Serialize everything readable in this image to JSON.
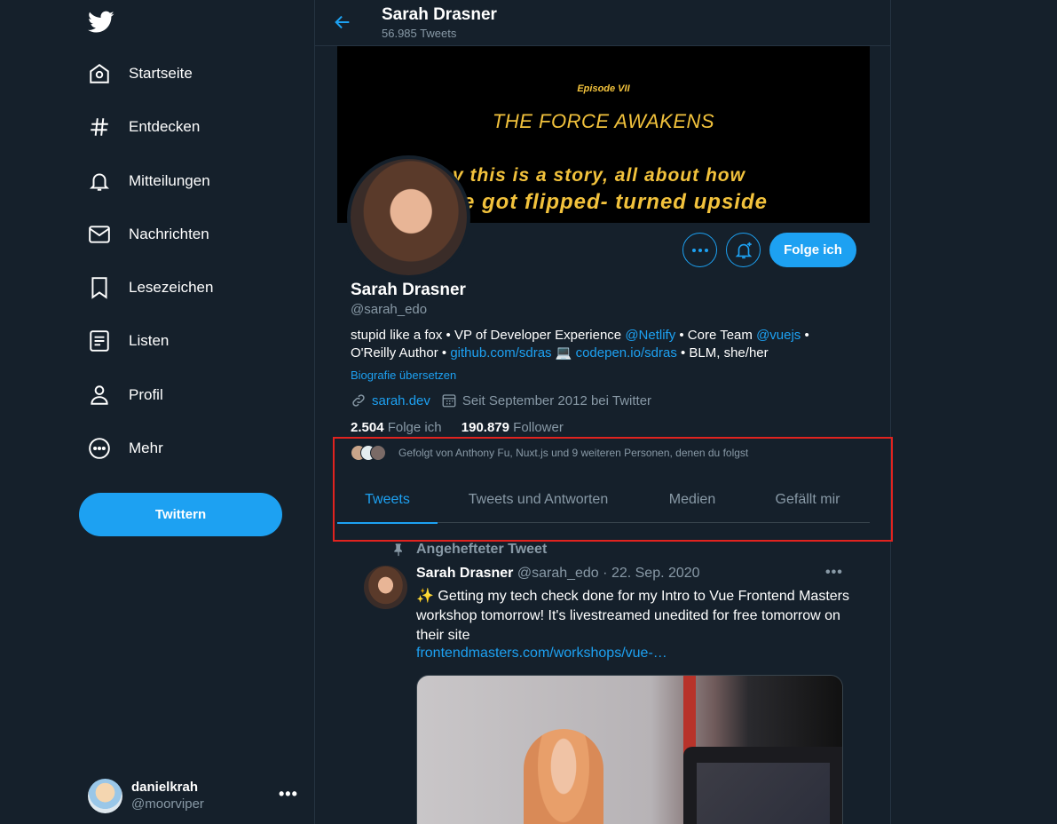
{
  "sidebar": {
    "logo": "twitter-bird-icon",
    "items": [
      {
        "label": "Startseite",
        "icon": "home-icon"
      },
      {
        "label": "Entdecken",
        "icon": "hashtag-icon"
      },
      {
        "label": "Mitteilungen",
        "icon": "bell-icon"
      },
      {
        "label": "Nachrichten",
        "icon": "mail-icon"
      },
      {
        "label": "Lesezeichen",
        "icon": "bookmark-icon"
      },
      {
        "label": "Listen",
        "icon": "list-icon"
      },
      {
        "label": "Profil",
        "icon": "profile-icon"
      },
      {
        "label": "Mehr",
        "icon": "more-circle-icon"
      }
    ],
    "tweet_button": "Twittern",
    "account": {
      "display_name": "danielkrah",
      "handle": "@moorviper",
      "more": "•••"
    }
  },
  "header": {
    "name": "Sarah Drasner",
    "tweet_count": "56.985 Tweets"
  },
  "banner": {
    "episode": "Episode VII",
    "title": "THE FORCE AWAKENS",
    "crawl_line1": "v this is a story, all about how",
    "crawl_line2": "fe got flipped- turned upside"
  },
  "profile": {
    "name": "Sarah Drasner",
    "handle": "@sarah_edo",
    "follow_button": "Folge ich",
    "more_button": "•••",
    "bio": {
      "part1": "stupid like a fox • VP of Developer Experience ",
      "link1": "@Netlify",
      "part2": " • Core Team ",
      "link2": "@vuejs",
      "part3": " • O'Reilly Author • ",
      "link3": "github.com/sdras",
      "part4": " 💻 ",
      "link4": "codepen.io/sdras",
      "part5": " • BLM, she/her"
    },
    "translate": "Biografie übersetzen",
    "website": "sarah.dev",
    "joined": "Seit September 2012 bei Twitter",
    "following_count": "2.504",
    "following_label": "Folge ich",
    "followers_count": "190.879",
    "followers_label": "Follower",
    "followed_by": "Gefolgt von Anthony Fu, Nuxt.js und 9 weiteren Personen, denen du folgst"
  },
  "tabs": [
    {
      "label": "Tweets",
      "active": true
    },
    {
      "label": "Tweets und Antworten",
      "active": false
    },
    {
      "label": "Medien",
      "active": false
    },
    {
      "label": "Gefällt mir",
      "active": false
    }
  ],
  "pinned_tweet": {
    "pinned_label": "Angehefteter Tweet",
    "name": "Sarah Drasner",
    "handle": "@sarah_edo",
    "separator": "·",
    "date": "22. Sep. 2020",
    "more": "•••",
    "text": "✨ Getting my tech check done for my Intro to Vue Frontend Masters workshop tomorrow! It's livestreamed unedited for free tomorrow on their site",
    "link": "frontendmasters.com/workshops/vue-…"
  },
  "colors": {
    "accent": "#1da1f2",
    "background": "#15202b",
    "secondary_text": "#8899a6",
    "highlight_box": "#e0231f"
  }
}
